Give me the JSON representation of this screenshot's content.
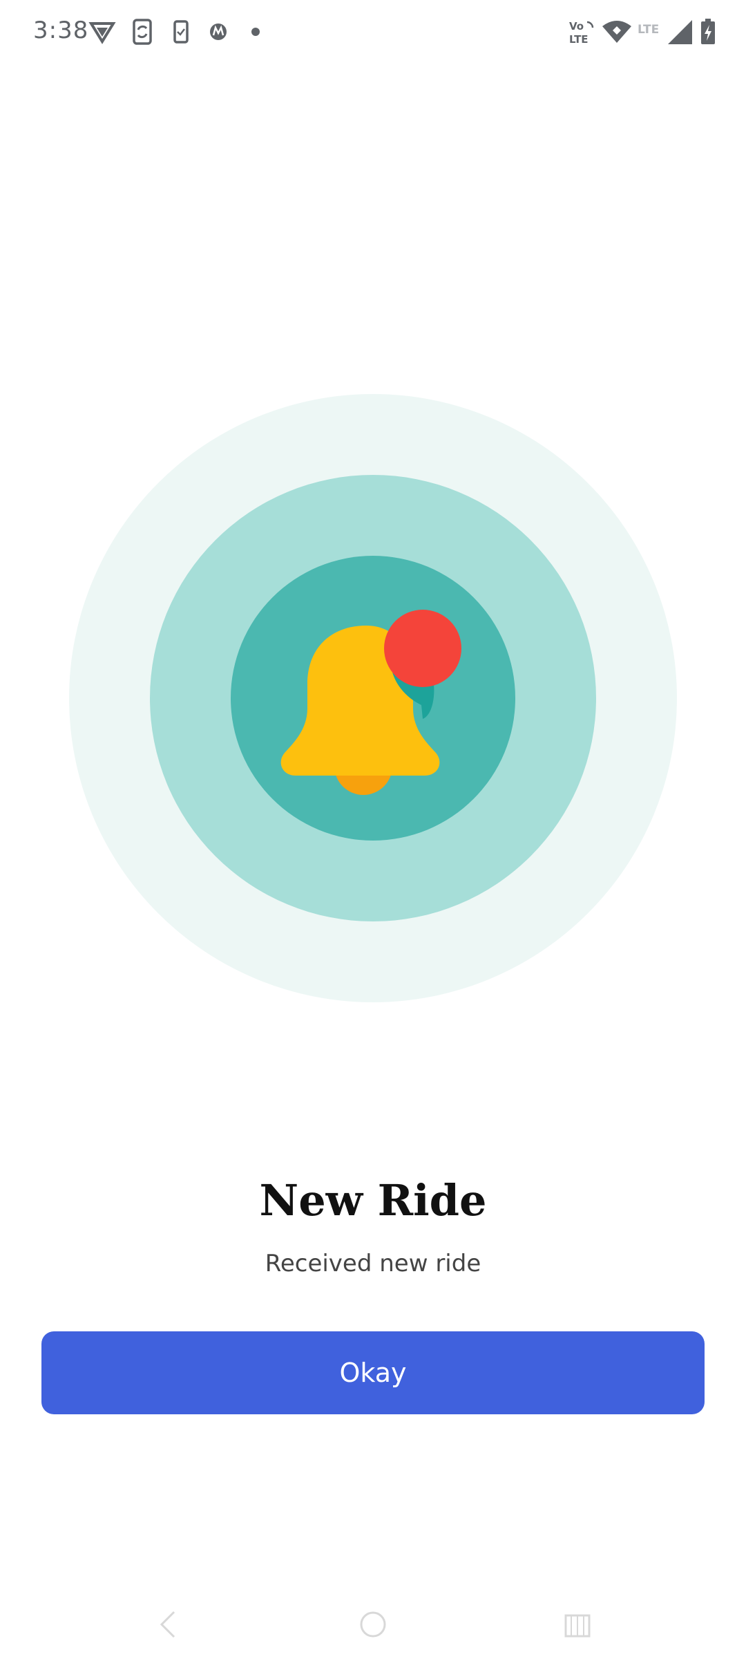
{
  "status_bar": {
    "time": "3:38",
    "icons": [
      "vpn-shield-icon",
      "phone-sync-icon",
      "phone-check-icon",
      "motorola-icon",
      "dot-icon",
      "volte-icon",
      "wifi-icon",
      "lte-icon",
      "signal-icon",
      "battery-charging-icon"
    ],
    "icon_color": "#5f6368"
  },
  "dialog": {
    "illustration": "bell-notification-icon",
    "title": "New Ride",
    "message": "Received new ride",
    "button_label": "Okay"
  },
  "colors": {
    "ring_outer": "#edf7f5",
    "ring_middle": "#a6ded8",
    "ring_inner": "#4bb8b0",
    "bell": "#fdc00e",
    "bell_clapper": "#f7a10d",
    "notification_dot": "#f4443a",
    "button": "#4061dd"
  },
  "nav_bar": {
    "buttons": [
      "back-icon",
      "home-icon",
      "recents-icon"
    ]
  }
}
